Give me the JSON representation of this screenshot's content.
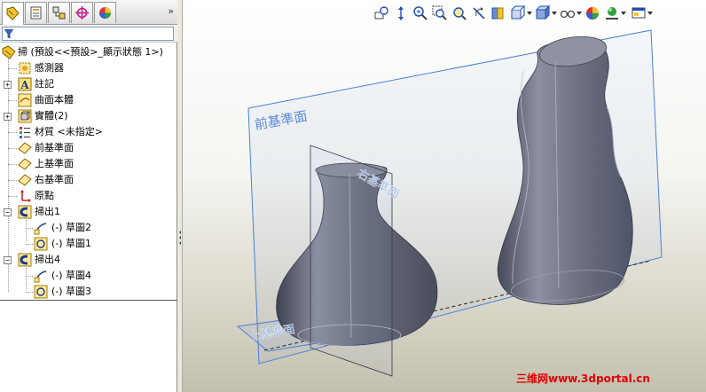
{
  "tree": {
    "root": "掃 (預設<<預設>_顯示狀態 1>)",
    "sensors": "感測器",
    "annotations": "註記",
    "surface_bodies": "曲面本體",
    "solid_bodies": "實體(2)",
    "material": "材質 <未指定>",
    "front_plane": "前基準面",
    "top_plane": "上基準面",
    "right_plane": "右基準面",
    "origin": "原點",
    "sweep1": "掃出1",
    "sweep1_sketch2": "(-) 草圖2",
    "sweep1_sketch1": "(-) 草圖1",
    "sweep4": "掃出4",
    "sweep4_sketch4": "(-) 草圖4",
    "sweep4_sketch3": "(-) 草圖3"
  },
  "viewport": {
    "front_plane_label": "前基準面",
    "right_plane_label": "右基準面",
    "top_plane_label": "上基準面"
  },
  "panel_more": "»",
  "expander_plus": "+",
  "expander_minus": "−",
  "watermark": "三维网www.3dportal.cn",
  "colors": {
    "model_body": "#6e7282",
    "plane_blue": "#4a7fd8",
    "watermark_red": "#e00000"
  },
  "icons": [
    "feature-manager-icon",
    "property-manager-icon",
    "configuration-manager-icon",
    "dim-xpert-icon",
    "display-manager-icon",
    "filter-icon"
  ]
}
